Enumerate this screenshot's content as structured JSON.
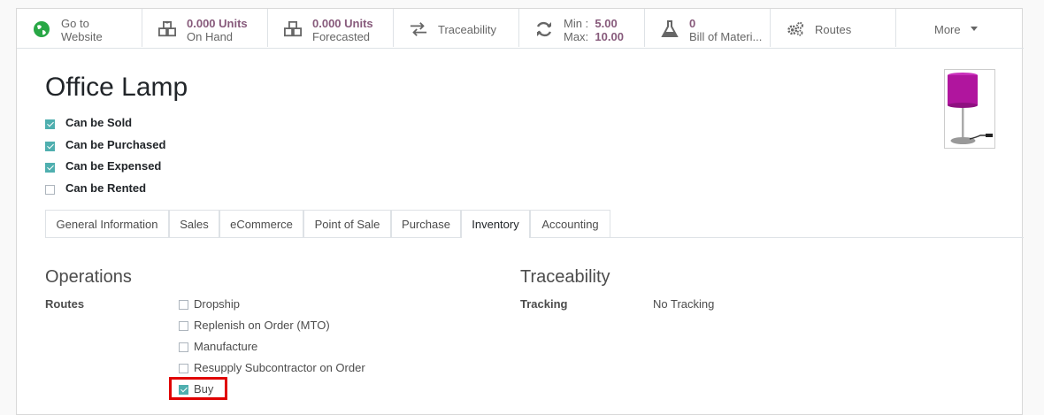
{
  "smart_buttons": [
    {
      "icon": "globe-icon",
      "line1": "Go to",
      "line2": "Website"
    },
    {
      "icon": "cubes-icon",
      "value": "0.000 Units",
      "label": "On Hand"
    },
    {
      "icon": "cubes-icon",
      "value": "0.000 Units",
      "label": "Forecasted"
    },
    {
      "icon": "arrows-exchange-icon",
      "label": "Traceability"
    },
    {
      "icon": "refresh-icon",
      "min_label": "Min :",
      "min_value": "5.00",
      "max_label": "Max:",
      "max_value": "10.00"
    },
    {
      "icon": "flask-icon",
      "value": "0",
      "label": "Bill of Materi..."
    },
    {
      "icon": "cogs-icon",
      "label": "Routes"
    },
    {
      "icon": "caret-down-icon",
      "label": "More"
    }
  ],
  "product": {
    "name": "Office Lamp",
    "options": [
      {
        "label": "Can be Sold",
        "checked": true
      },
      {
        "label": "Can be Purchased",
        "checked": true
      },
      {
        "label": "Can be Expensed",
        "checked": true
      },
      {
        "label": "Can be Rented",
        "checked": false
      }
    ]
  },
  "tabs": [
    "General Information",
    "Sales",
    "eCommerce",
    "Point of Sale",
    "Purchase",
    "Inventory",
    "Accounting"
  ],
  "active_tab": "Inventory",
  "operations": {
    "title": "Operations",
    "routes_label": "Routes",
    "routes": [
      {
        "label": "Dropship",
        "checked": false
      },
      {
        "label": "Replenish on Order (MTO)",
        "checked": false
      },
      {
        "label": "Manufacture",
        "checked": false
      },
      {
        "label": "Resupply Subcontractor on Order",
        "checked": false
      },
      {
        "label": "Buy",
        "checked": true
      }
    ]
  },
  "traceability": {
    "title": "Traceability",
    "tracking_label": "Tracking",
    "tracking_value": "No Tracking"
  },
  "colors": {
    "accent": "#875a7b",
    "checkbox": "#4fafaf",
    "highlight": "#e00000",
    "lamp_shade": "#b0159e"
  }
}
